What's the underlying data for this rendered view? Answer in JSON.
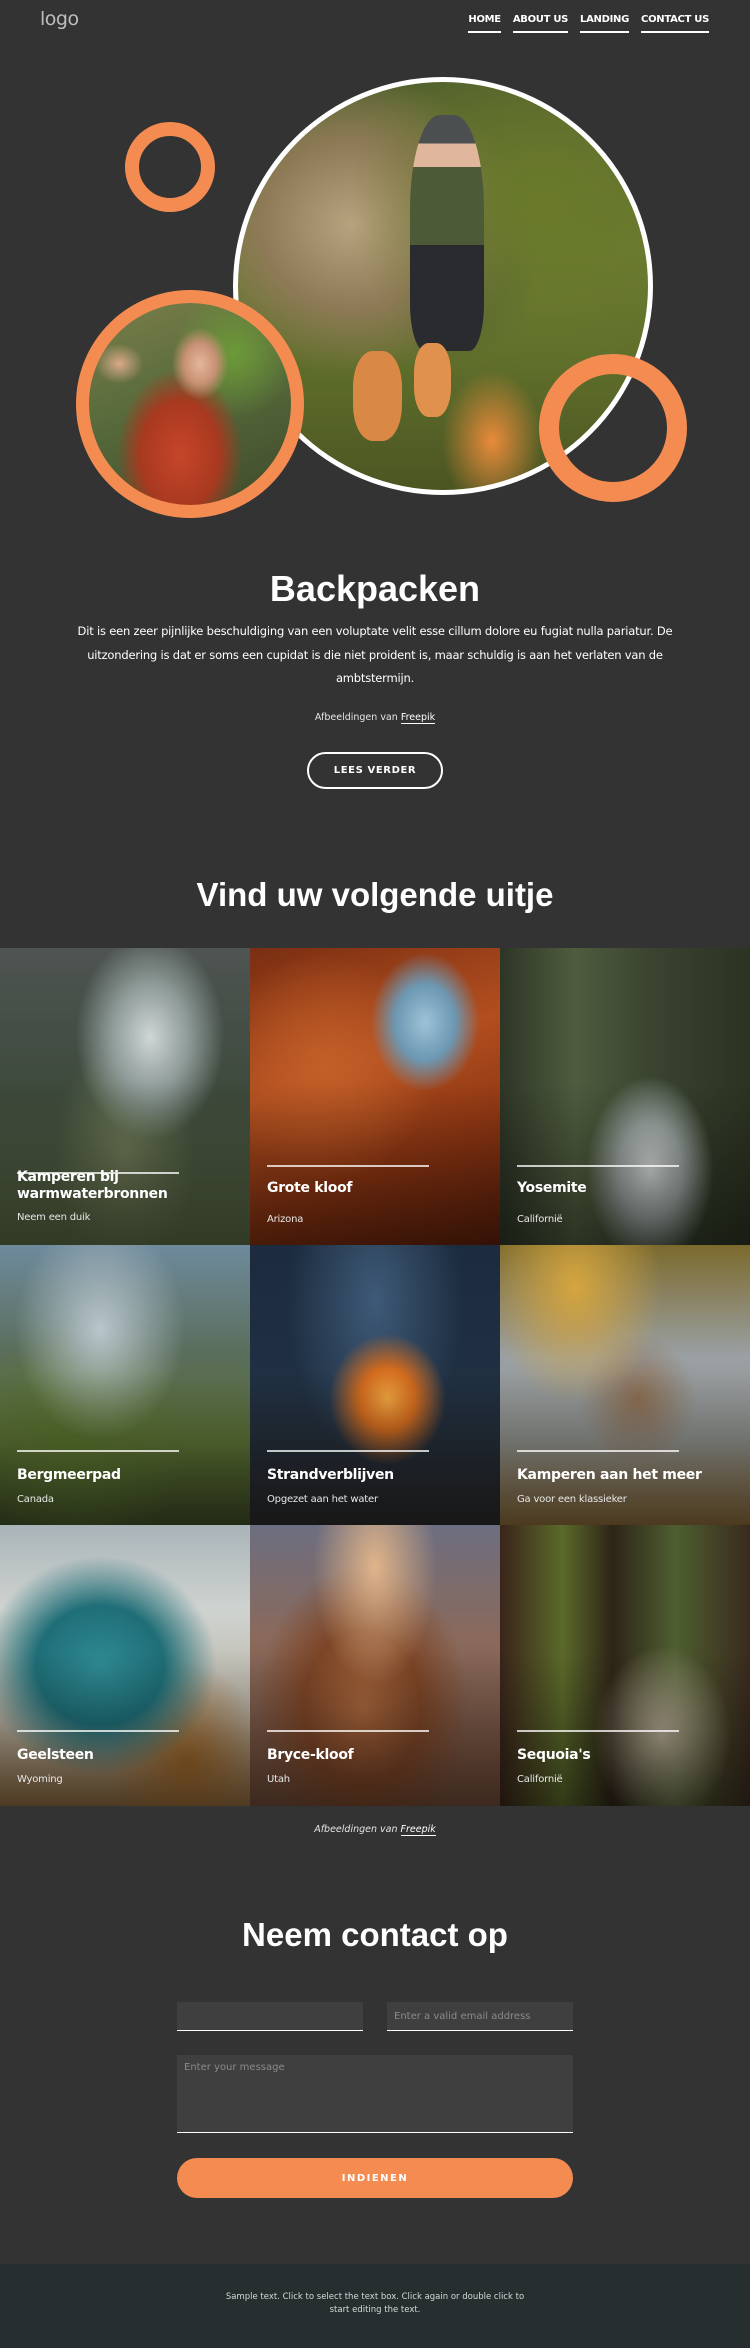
{
  "header": {
    "logo": "logo",
    "nav": [
      {
        "label": "HOME"
      },
      {
        "label": "ABOUT US"
      },
      {
        "label": "LANDING"
      },
      {
        "label": "CONTACT US"
      }
    ]
  },
  "hero": {
    "title": "Backpacken",
    "text": "Dit is een zeer pijnlijke beschuldiging van een voluptate velit esse cillum dolore eu fugiat nulla pariatur. De uitzondering is dat er soms een cupidat is die niet proident is, maar schuldig is aan het verlaten van de ambtstermijn.",
    "credit_prefix": "Afbeeldingen van",
    "credit_link": "Freepik",
    "button_label": "LEES VERDER"
  },
  "destinations": {
    "title": "Vind uw volgende uitje",
    "items": [
      {
        "title": "Kamperen bij warmwaterbronnen",
        "subtitle": "Neem een duik"
      },
      {
        "title": "Grote kloof",
        "subtitle": "Arizona"
      },
      {
        "title": "Yosemite",
        "subtitle": "Californië"
      },
      {
        "title": "Bergmeerpad",
        "subtitle": "Canada"
      },
      {
        "title": "Strandverblijven",
        "subtitle": "Opgezet aan het water"
      },
      {
        "title": "Kamperen aan het meer",
        "subtitle": "Ga voor een klassieker"
      },
      {
        "title": "Geelsteen",
        "subtitle": "Wyoming"
      },
      {
        "title": "Bryce-kloof",
        "subtitle": "Utah"
      },
      {
        "title": "Sequoia's",
        "subtitle": "Californië"
      }
    ],
    "credit_prefix": "Afbeeldingen van",
    "credit_link": "Freepik"
  },
  "contact": {
    "title": "Neem contact op",
    "name_placeholder": "",
    "email_placeholder": "Enter a valid email address",
    "message_placeholder": "Enter your message",
    "submit_label": "INDIENEN"
  },
  "footer": {
    "text": "Sample text. Click to select the text box. Click again or double click to start editing the text."
  },
  "colors": {
    "background": "#333333",
    "accent": "#f48c52",
    "footer": "#262e2f"
  }
}
